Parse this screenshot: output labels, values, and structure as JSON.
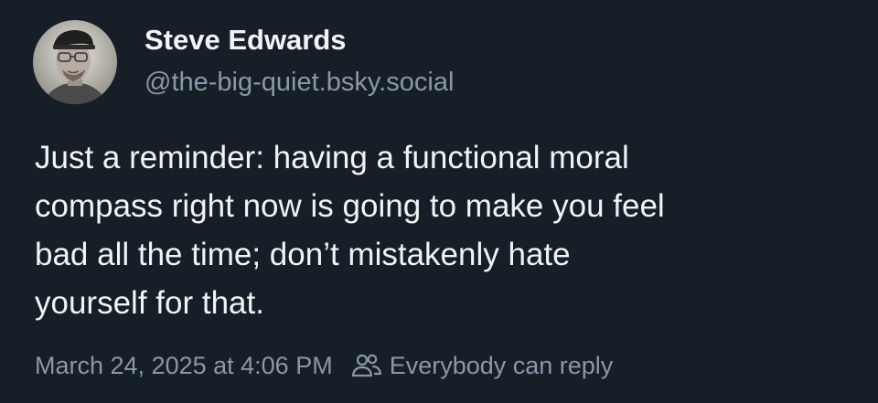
{
  "post": {
    "author": {
      "display_name": "Steve Edwards",
      "handle": "@the-big-quiet.bsky.social",
      "avatar": "avatar-photo"
    },
    "text": "Just a reminder: having a functional moral\ncompass right now is going to make you feel\nbad all the time; don’t mistakenly hate\nyourself for that.",
    "timestamp": "March 24, 2025 at 4:06 PM",
    "reply_setting": {
      "icon": "people-icon",
      "label": "Everybody can reply"
    }
  },
  "colors": {
    "background": "#161e27",
    "primary_text": "#f1f3f5",
    "secondary_text": "#8a98a8"
  }
}
